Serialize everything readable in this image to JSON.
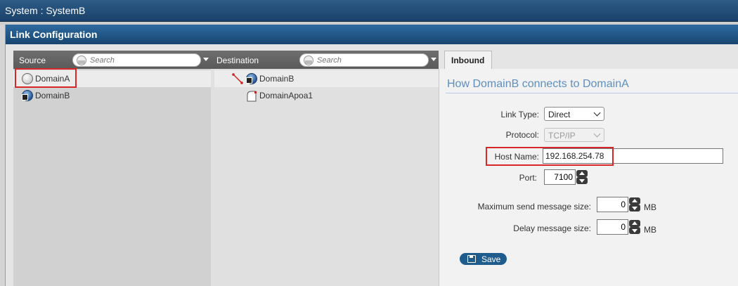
{
  "window": {
    "title": "System : SystemB"
  },
  "dialog": {
    "title": "Link Configuration"
  },
  "source": {
    "header": "Source",
    "search_placeholder": "Search",
    "items": [
      {
        "label": "DomainA",
        "icon": "globe-white-icon"
      },
      {
        "label": "DomainB",
        "icon": "globe-server-icon"
      }
    ]
  },
  "destination": {
    "header": "Destination",
    "search_placeholder": "Search",
    "items": [
      {
        "label": "DomainB",
        "icon": "globe-server-icon"
      },
      {
        "label": "DomainApoa1",
        "icon": "post-office-icon"
      }
    ]
  },
  "inbound": {
    "tab_label": "Inbound",
    "heading": "How DomainB connects to DomainA",
    "link_type_label": "Link Type:",
    "link_type_value": "Direct",
    "protocol_label": "Protocol:",
    "protocol_value": "TCP/IP",
    "host_name_label": "Host Name:",
    "host_name_value": "192.168.254.78",
    "port_label": "Port:",
    "port_value": "7100",
    "max_send_label": "Maximum send message size:",
    "max_send_value": "0",
    "max_send_unit": "MB",
    "delay_label": "Delay message size:",
    "delay_value": "0",
    "delay_unit": "MB",
    "save_label": "Save"
  },
  "colors": {
    "title_bar": "#1b426a",
    "highlight": "#d62828",
    "heading": "#5e8fbf",
    "save_button": "#1e5c8d"
  }
}
